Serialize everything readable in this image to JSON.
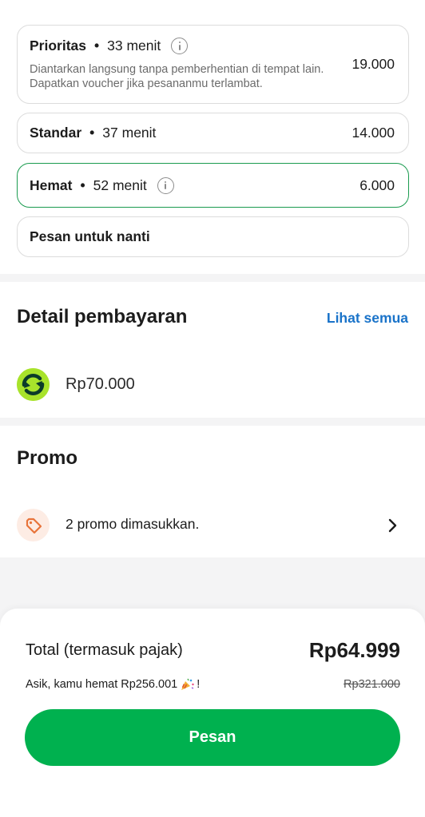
{
  "delivery_options": {
    "prioritas": {
      "name": "Prioritas",
      "separator": "•",
      "eta": "33 menit",
      "description": "Diantarkan langsung tanpa pemberhentian di tempat lain. Dapatkan voucher jika pesananmu terlambat.",
      "price": "19.000"
    },
    "standar": {
      "name": "Standar",
      "separator": "•",
      "eta": "37 menit",
      "price": "14.000"
    },
    "hemat": {
      "name": "Hemat",
      "separator": "•",
      "eta": "52 menit",
      "price": "6.000",
      "selected": true
    },
    "schedule": {
      "name": "Pesan untuk nanti"
    }
  },
  "payment": {
    "title": "Detail pembayaran",
    "see_all": "Lihat semua",
    "amount": "Rp70.000",
    "logo_icon": "wallet-logo-icon"
  },
  "promo": {
    "title": "Promo",
    "text": "2 promo dimasukkan.",
    "icon": "tag-icon"
  },
  "summary": {
    "total_label": "Total (termasuk pajak)",
    "total_value": "Rp64.999",
    "savings_prefix": "Asik, kamu hemat Rp256.001",
    "savings_suffix": "!",
    "original_price": "Rp321.000",
    "button_label": "Pesan"
  },
  "colors": {
    "accent_green": "#00b14f",
    "selected_border": "#1a9b4f",
    "link_blue": "#1a73c9",
    "wallet_lime": "#a8e32b",
    "promo_orange": "#e8743b"
  }
}
